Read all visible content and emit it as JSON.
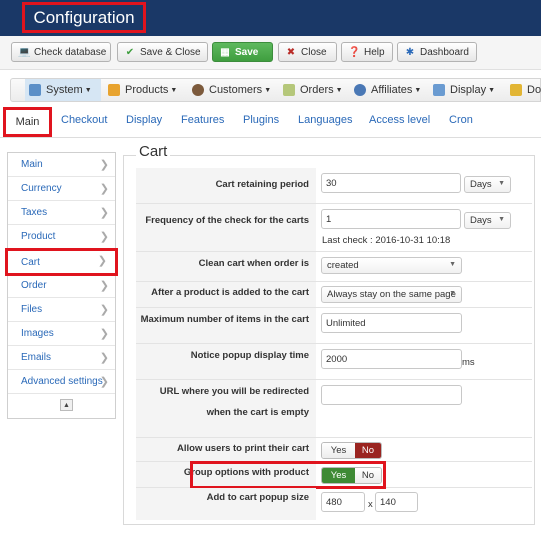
{
  "header": {
    "title": "Configuration"
  },
  "toolbar": {
    "check_database": "Check database",
    "save_close": "Save & Close",
    "save": "Save",
    "close": "Close",
    "help": "Help",
    "dashboard": "Dashboard"
  },
  "menu": {
    "system": "System",
    "products": "Products",
    "customers": "Customers",
    "orders": "Orders",
    "affiliates": "Affiliates",
    "display": "Display",
    "doc": "Doc"
  },
  "tabs": {
    "main": "Main",
    "checkout": "Checkout",
    "display": "Display",
    "features": "Features",
    "plugins": "Plugins",
    "languages": "Languages",
    "access_level": "Access level",
    "cron": "Cron"
  },
  "sidebar": {
    "items": [
      "Main",
      "Currency",
      "Taxes",
      "Product",
      "Cart",
      "Order",
      "Files",
      "Images",
      "Emails",
      "Advanced settings"
    ],
    "active": "Cart"
  },
  "section": {
    "legend": "Cart"
  },
  "fields": {
    "retaining_label": "Cart retaining period",
    "retaining_value": "30",
    "retaining_unit": "Days",
    "frequency_label": "Frequency of the check for the carts",
    "frequency_value": "1",
    "frequency_unit": "Days",
    "last_check": "Last check : 2016-10-31 10:18",
    "clean_label": "Clean cart when order is",
    "clean_value": "created",
    "after_add_label": "After a product is added to the cart",
    "after_add_value": "Always stay on the same page",
    "max_items_label": "Maximum number of items in the cart",
    "max_items_value": "Unlimited",
    "notice_label": "Notice popup display time",
    "notice_value": "2000",
    "notice_unit": "ms",
    "redirect_label_1": "URL where you will be redirected",
    "redirect_label_2": "when the cart is empty",
    "redirect_value": "",
    "print_label": "Allow users to print their cart",
    "print_yes": "Yes",
    "print_no": "No",
    "print_selected": "No",
    "group_label": "Group options with product",
    "group_yes": "Yes",
    "group_no": "No",
    "group_selected": "Yes",
    "popup_size_label": "Add to cart popup size",
    "popup_width": "480",
    "popup_x": "x",
    "popup_height": "140"
  },
  "colors": {
    "header_bg": "#1a3867",
    "highlight": "#e0141e",
    "save_green": "#46a546",
    "no_red": "#9a2420",
    "yes_green": "#3e8a35",
    "link_blue": "#2a69b8"
  }
}
